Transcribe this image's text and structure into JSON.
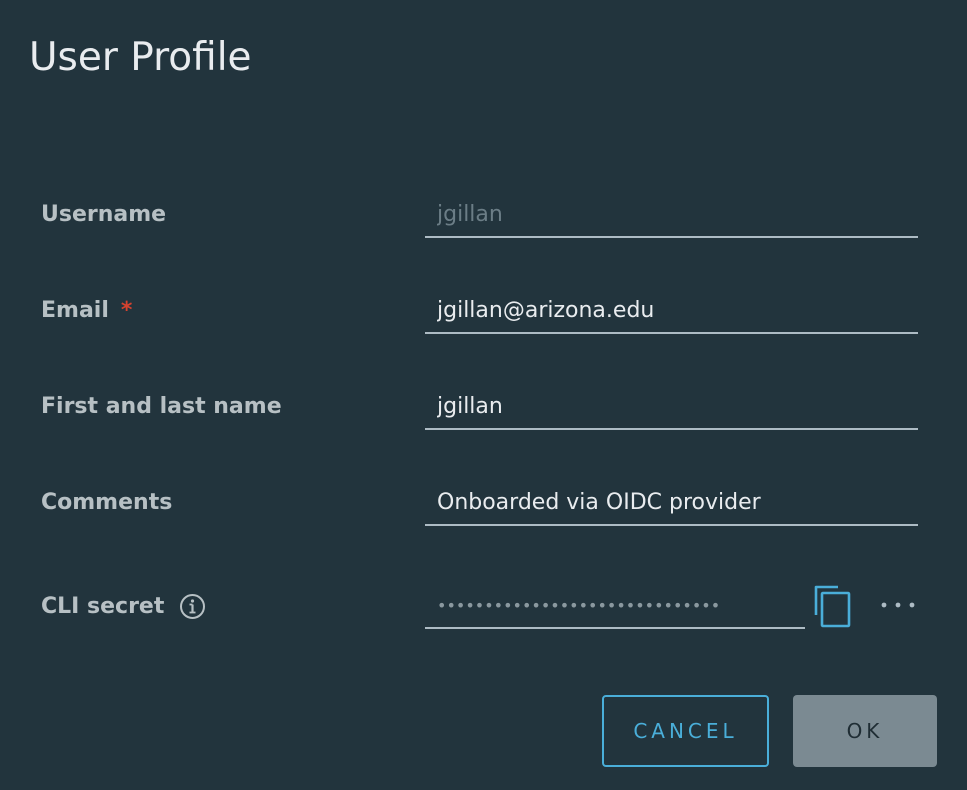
{
  "dialog": {
    "title": "User Profile"
  },
  "form": {
    "username": {
      "label": "Username",
      "value": "jgillan"
    },
    "email": {
      "label": "Email",
      "required_mark": "*",
      "value": "jgillan@arizona.edu"
    },
    "full_name": {
      "label": "First and last name",
      "value": "jgillan"
    },
    "comments": {
      "label": "Comments",
      "value": "Onboarded via OIDC provider"
    },
    "cli_secret": {
      "label": "CLI secret",
      "value": "••••••••••••••••••••••••••••••",
      "info_icon": "info-circle-icon",
      "copy_icon": "copy-icon",
      "more_icon": "ellipsis-horizontal-icon"
    }
  },
  "buttons": {
    "cancel": "CANCEL",
    "ok": "OK"
  },
  "colors": {
    "background": "#22343d",
    "accent": "#4aaed9",
    "required": "#d6422f",
    "ok_button": "#7b8a92"
  }
}
